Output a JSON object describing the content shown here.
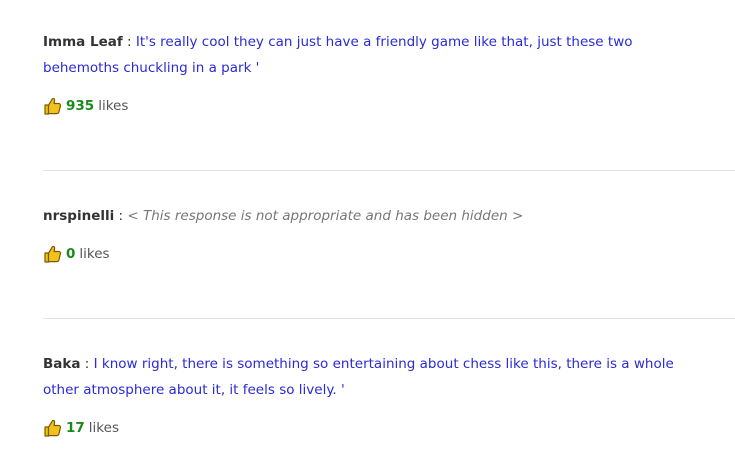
{
  "comments": [
    {
      "author": "Imma Leaf",
      "separator": " : ",
      "text": "It's really cool they can just have a friendly game like that, just these two behemoths chuckling in a park '",
      "hidden": false,
      "likes_count": "935",
      "likes_label": "likes"
    },
    {
      "author": "nrspinelli",
      "separator": " : ",
      "text": "< This response is not appropriate and has been hidden >",
      "hidden": true,
      "likes_count": "0",
      "likes_label": "likes"
    },
    {
      "author": "Baka",
      "separator": " : ",
      "text": "I know right, there is something so entertaining about chess like this, there is a whole other atmosphere about it, it feels so lively. '",
      "hidden": false,
      "likes_count": "17",
      "likes_label": "likes"
    }
  ],
  "icons": {
    "like": "thumbs-up-icon"
  },
  "colors": {
    "author": "#333333",
    "comment_text": "#2a2ad6",
    "hidden_text": "#777777",
    "like_count": "#1a8a1a",
    "thumb_fill": "#f2c21b",
    "divider": "#e2e2e2"
  }
}
